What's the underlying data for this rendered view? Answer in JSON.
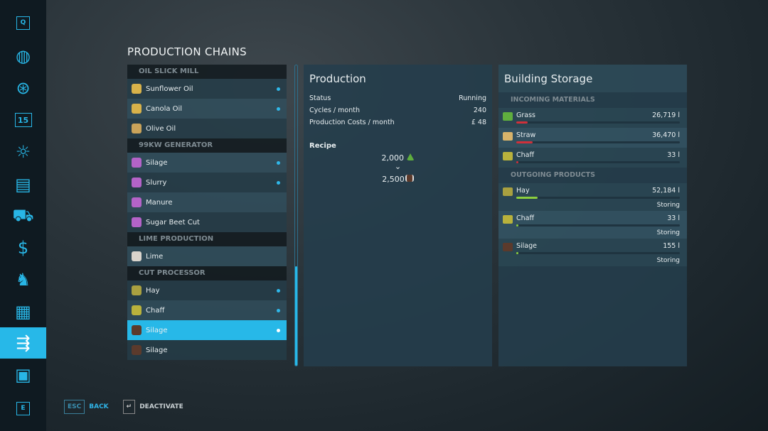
{
  "sidebar": {
    "items": [
      {
        "icon": "q-key-icon",
        "label": "Q"
      },
      {
        "icon": "map-icon"
      },
      {
        "icon": "steering-wheel-icon"
      },
      {
        "icon": "calendar-icon",
        "label": "15"
      },
      {
        "icon": "weather-icon"
      },
      {
        "icon": "statistics-icon"
      },
      {
        "icon": "tractor-icon"
      },
      {
        "icon": "finances-icon"
      },
      {
        "icon": "animals-icon"
      },
      {
        "icon": "contracts-icon"
      },
      {
        "icon": "production-icon",
        "active": true
      },
      {
        "icon": "help-icon"
      },
      {
        "icon": "e-key-icon",
        "label": "E"
      }
    ]
  },
  "title": "PRODUCTION CHAINS",
  "list": [
    {
      "header": "OIL SLICK MILL",
      "items": [
        {
          "label": "Sunflower Oil",
          "icon": "sunflower-oil-icon",
          "color": "#d8b24a",
          "active": true
        },
        {
          "label": "Canola Oil",
          "icon": "canola-oil-icon",
          "color": "#d8b24a",
          "active": true
        },
        {
          "label": "Olive Oil",
          "icon": "olive-oil-icon",
          "color": "#c9a35a",
          "active": false
        }
      ]
    },
    {
      "header": "99KW GENERATOR",
      "items": [
        {
          "label": "Silage",
          "icon": "electricity-icon",
          "color": "#b463c8",
          "active": true
        },
        {
          "label": "Slurry",
          "icon": "electricity-icon",
          "color": "#b463c8",
          "active": true
        },
        {
          "label": "Manure",
          "icon": "electricity-icon",
          "color": "#b463c8",
          "active": false
        },
        {
          "label": "Sugar Beet Cut",
          "icon": "electricity-icon",
          "color": "#b463c8",
          "active": false
        }
      ]
    },
    {
      "header": "LIME PRODUCTION",
      "items": [
        {
          "label": "Lime",
          "icon": "lime-icon",
          "color": "#d9d4cc",
          "active": false
        }
      ]
    },
    {
      "header": "CUT PROCESSOR",
      "items": [
        {
          "label": "Hay",
          "icon": "hay-icon",
          "color": "#a9a040",
          "active": true
        },
        {
          "label": "Chaff",
          "icon": "chaff-icon",
          "color": "#b9b23c",
          "active": true
        },
        {
          "label": "Silage",
          "icon": "silage-icon",
          "color": "#5b3a2c",
          "active": true,
          "selected": true
        },
        {
          "label": "Silage",
          "icon": "silage-icon",
          "color": "#5b3a2c",
          "active": false
        }
      ]
    }
  ],
  "production": {
    "title": "Production",
    "stats": [
      {
        "label": "Status",
        "value": "Running"
      },
      {
        "label": "Cycles / month",
        "value": "240"
      },
      {
        "label": "Production Costs / month",
        "value": "£ 48"
      }
    ],
    "recipe_label": "Recipe",
    "input": {
      "amount": "2,000",
      "icon": "grass-icon"
    },
    "arrow": "⌄",
    "output": {
      "amount": "2,500",
      "icon": "silage-icon"
    }
  },
  "storage": {
    "title": "Building Storage",
    "incoming_label": "INCOMING MATERIALS",
    "incoming": [
      {
        "label": "Grass",
        "value": "26,719 l",
        "fill_pct": 7,
        "icon": "grass-icon",
        "icon_color": "#5fae3e"
      },
      {
        "label": "Straw",
        "value": "36,470 l",
        "fill_pct": 10,
        "icon": "straw-icon",
        "icon_color": "#d7b36a"
      },
      {
        "label": "Chaff",
        "value": "33 l",
        "fill_pct": 1,
        "icon": "chaff-icon",
        "icon_color": "#b9b23c"
      }
    ],
    "outgoing_label": "OUTGOING PRODUCTS",
    "outgoing": [
      {
        "label": "Hay",
        "value": "52,184 l",
        "fill_pct": 13,
        "status": "Storing",
        "icon": "hay-icon",
        "icon_color": "#a9a040"
      },
      {
        "label": "Chaff",
        "value": "33 l",
        "fill_pct": 1,
        "status": "Storing",
        "icon": "chaff-icon",
        "icon_color": "#b9b23c"
      },
      {
        "label": "Silage",
        "value": "155 l",
        "fill_pct": 1,
        "status": "Storing",
        "icon": "silage-icon",
        "icon_color": "#5b3a2c"
      }
    ],
    "incoming_bar_color": "#d0303a",
    "outgoing_bar_color": "#8ccf3e"
  },
  "footer": {
    "back_key": "ESC",
    "back_label": "BACK",
    "deactivate_key": "↵",
    "deactivate_label": "DEACTIVATE"
  }
}
